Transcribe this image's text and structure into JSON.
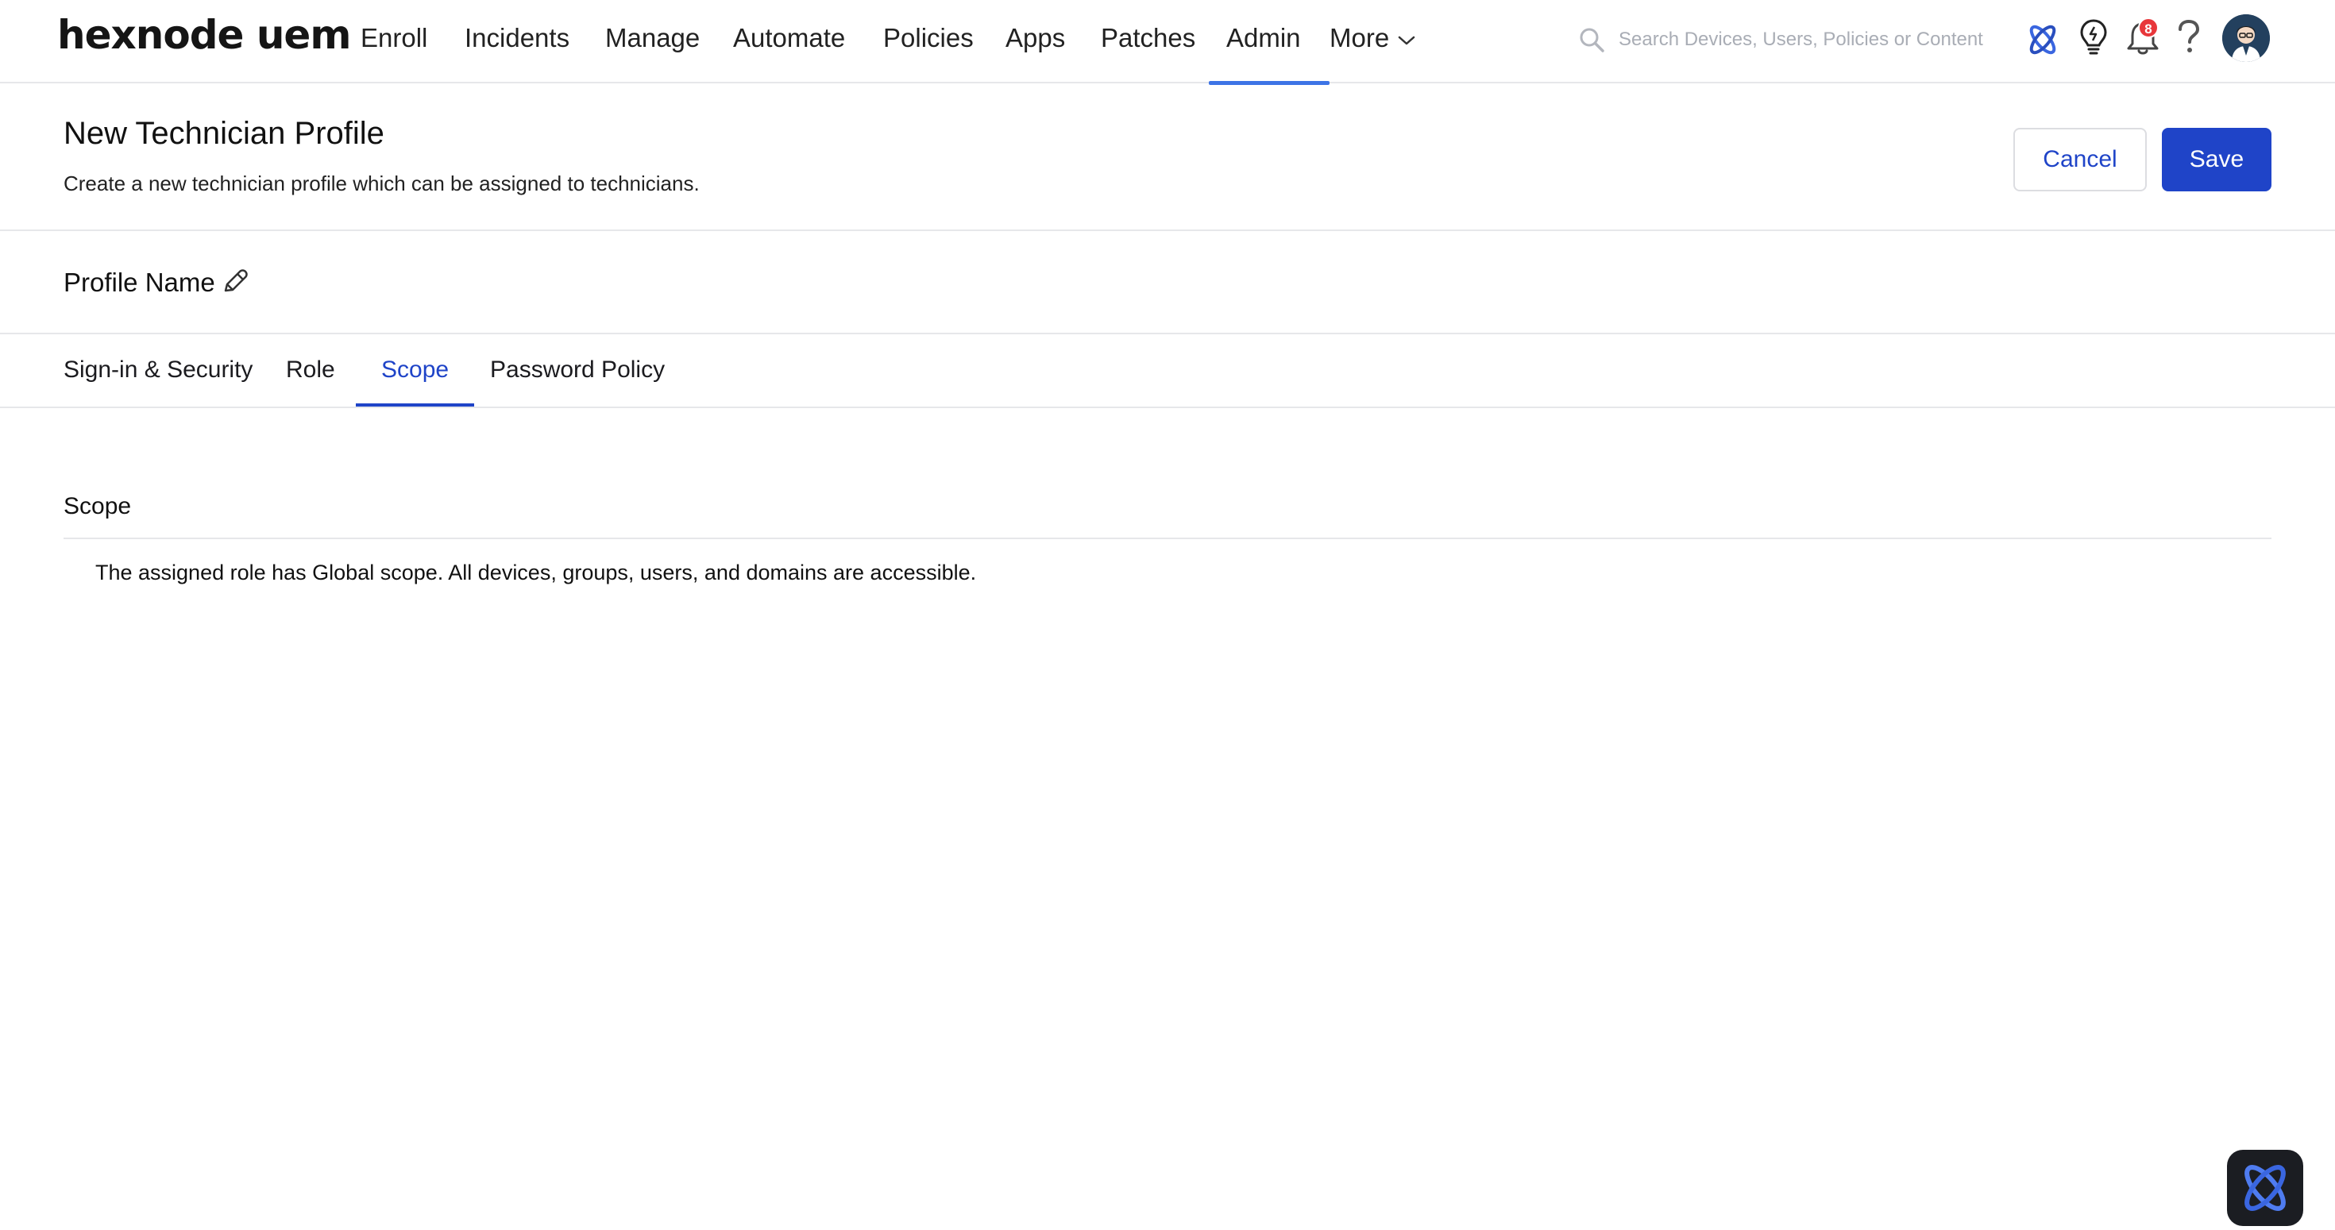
{
  "brand": {
    "logo_text": "hexnode uem"
  },
  "nav": {
    "items": [
      {
        "label": "Enroll"
      },
      {
        "label": "Incidents"
      },
      {
        "label": "Manage"
      },
      {
        "label": "Automate"
      },
      {
        "label": "Policies"
      },
      {
        "label": "Apps"
      },
      {
        "label": "Patches"
      },
      {
        "label": "Admin",
        "active": true
      }
    ],
    "more_label": "More"
  },
  "search": {
    "placeholder": "Search Devices, Users, Policies or Content",
    "icon": "search-icon"
  },
  "header_icons": {
    "assistant": "hexnode-assistant-icon",
    "tips": "lightbulb-icon",
    "notifications": "bell-icon",
    "notification_count": "8",
    "help": "help-icon",
    "avatar": "user-avatar"
  },
  "page": {
    "title": "New Technician Profile",
    "subtitle": "Create a new technician profile which can be assigned to technicians.",
    "cancel_label": "Cancel",
    "save_label": "Save"
  },
  "profile": {
    "name_label": "Profile Name",
    "edit_icon": "pencil-icon"
  },
  "tabs": [
    {
      "label": "Sign-in & Security"
    },
    {
      "label": "Role"
    },
    {
      "label": "Scope",
      "active": true
    },
    {
      "label": "Password Policy"
    }
  ],
  "scope": {
    "title": "Scope",
    "description": "The assigned role has Global scope. All devices, groups, users, and domains are accessible."
  },
  "colors": {
    "primary": "#1f44c8",
    "nav_active_underline": "#3d74e6",
    "badge": "#e8373b",
    "divider": "#e6e7ea"
  }
}
